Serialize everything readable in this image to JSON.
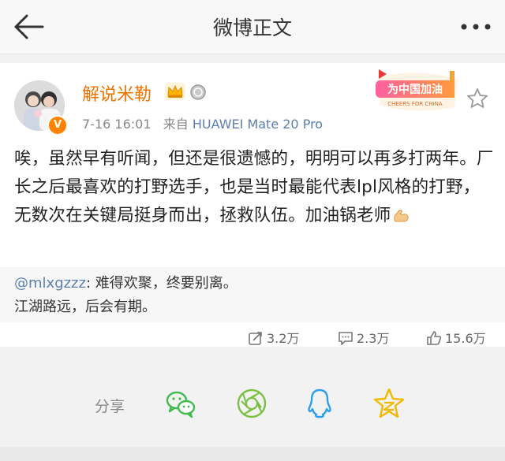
{
  "topbar": {
    "title": "微博正文"
  },
  "post": {
    "author": "解说米勒",
    "time": "7-16 16:01",
    "from_label": "来自",
    "source": "HUAWEI Mate 20 Pro",
    "verified_badge": "V",
    "promo_badge": {
      "title": "为中国加油",
      "subtitle": "CHEERS FOR CHINA"
    },
    "text": "唉，虽然早有听闻，但还是很遗憾的，明明可以再多打两年。厂长之后最喜欢的打野选手，也是当时最能代表lpl风格的打野，无数次在关键局挺身而出，拯救队伍。加油锅老师"
  },
  "quote": {
    "mention": "@mlxgzzz",
    "line1_rest": ": 难得欢聚，终要别离。",
    "line2": "江湖路远，后会有期。"
  },
  "actions": {
    "repost": "3.2万",
    "comment": "2.3万",
    "like": "15.6万"
  },
  "share": {
    "label": "分享"
  },
  "icons": [
    "back-icon",
    "more-icon",
    "crown-icon",
    "medal-icon",
    "star-outline-icon",
    "muscle-icon",
    "repost-icon",
    "comment-icon",
    "like-icon",
    "wechat-icon",
    "moments-icon",
    "qq-icon",
    "qzone-icon"
  ],
  "colors": {
    "username": "#f07300",
    "link": "#5b7fae",
    "wechat": "#3fbb4f",
    "moments": "#7bc043",
    "qq": "#2d9fea",
    "qzone": "#f5b800"
  }
}
